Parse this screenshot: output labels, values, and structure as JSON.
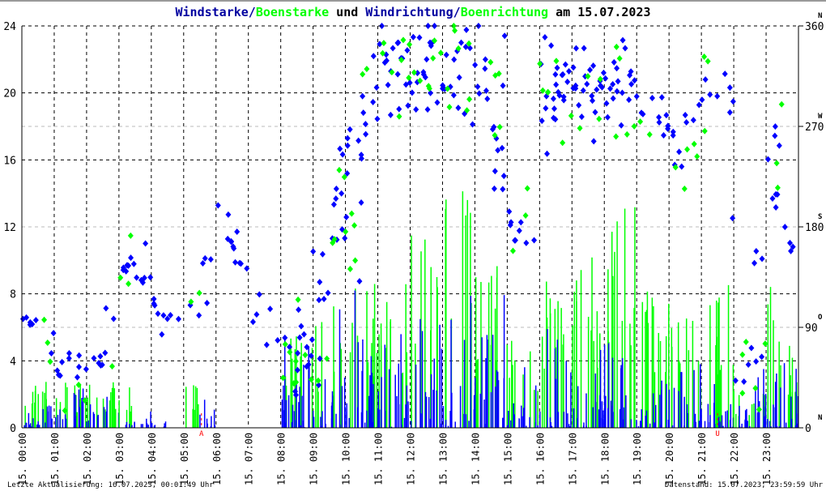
{
  "chart_data": {
    "type": "bar+scatter",
    "title_parts": [
      "Windstarke",
      "/",
      "Boenstarke",
      " und ",
      "Windrichtung",
      "/",
      "Boenrichtung",
      " am 15.07.2023"
    ],
    "left_axis": {
      "ylim": [
        0,
        24
      ],
      "ticks": [
        "0",
        "4",
        "8",
        "12",
        "16",
        "20",
        "24"
      ]
    },
    "right_axis": {
      "ylim": [
        0,
        360
      ],
      "ticks": [
        "0",
        "90",
        "180",
        "270",
        "360"
      ],
      "compass": [
        "N",
        "O",
        "S",
        "W",
        "N"
      ]
    },
    "x_ticks": [
      "15. 00:00",
      "15. 01:00",
      "15. 02:00",
      "15. 03:00",
      "15. 04:00",
      "15. 05:00",
      "15. 06:00",
      "15. 07:00",
      "15. 08:00",
      "15. 09:00",
      "15. 10:00",
      "15. 11:00",
      "15. 12:00",
      "15. 13:00",
      "15. 14:00",
      "15. 15:00",
      "15. 16:00",
      "15. 17:00",
      "15. 18:00",
      "15. 19:00",
      "15. 20:00",
      "15. 21:00",
      "15. 22:00",
      "15. 23:00"
    ],
    "markers": [
      {
        "label": "A",
        "hour": 5.55
      },
      {
        "label": "U",
        "hour": 21.5
      }
    ],
    "x_unit": "half-hour index (0-47)",
    "series": [
      {
        "name": "Windstarke",
        "color": "#0000ff",
        "kind": "bar",
        "values": [
          0.5,
          1,
          1,
          1.5,
          1,
          1.5,
          0.5,
          0.5,
          0.3,
          0,
          0,
          1,
          0,
          0,
          0,
          0,
          3,
          3,
          3,
          4,
          4,
          4,
          3,
          3,
          4,
          4,
          5,
          5,
          4,
          4,
          2,
          2,
          3,
          3,
          3,
          3,
          3,
          3,
          2,
          2,
          2,
          2,
          2,
          1,
          1,
          2,
          2,
          2
        ]
      },
      {
        "name": "Boenstarke",
        "color": "#00ff00",
        "kind": "bar",
        "values": [
          2.5,
          2.5,
          2.5,
          2.5,
          2.5,
          2.5,
          2.5,
          0,
          0,
          0,
          2.5,
          0,
          0,
          0,
          0,
          0,
          5,
          6,
          6,
          7,
          8,
          8,
          8,
          8,
          11,
          12,
          14,
          13,
          10,
          10,
          5,
          5,
          8,
          8,
          10,
          10,
          12,
          12,
          8,
          8,
          6,
          6,
          8,
          8,
          2,
          2,
          8,
          5
        ]
      },
      {
        "name": "Windrichtung",
        "color": "#0000ff",
        "kind": "scatter",
        "values": [
          100,
          90,
          60,
          60,
          55,
          60,
          150,
          150,
          100,
          100,
          100,
          118,
          185,
          180,
          100,
          95,
          70,
          70,
          80,
          200,
          180,
          300,
          330,
          320,
          330,
          340,
          330,
          320,
          330,
          300,
          180,
          180,
          300,
          300,
          310,
          300,
          300,
          300,
          300,
          280,
          250,
          260,
          300,
          300,
          60,
          60,
          250,
          160
        ]
      },
      {
        "name": "Boenrichtung",
        "color": "#00ff00",
        "kind": "scatter",
        "values": [
          100,
          90,
          60,
          60,
          55,
          60,
          150,
          150,
          100,
          100,
          100,
          118,
          185,
          180,
          100,
          95,
          70,
          70,
          80,
          200,
          180,
          300,
          330,
          320,
          330,
          340,
          330,
          320,
          330,
          300,
          180,
          180,
          300,
          300,
          310,
          300,
          300,
          300,
          300,
          280,
          250,
          260,
          300,
          300,
          60,
          60,
          250,
          160
        ]
      }
    ],
    "footer_left": "Letzte Aktualisierung: 16.07.2023, 00:01:49 Uhr",
    "footer_right": "Datenstand: 15.07.2023, 23:59:59 Uhr"
  }
}
